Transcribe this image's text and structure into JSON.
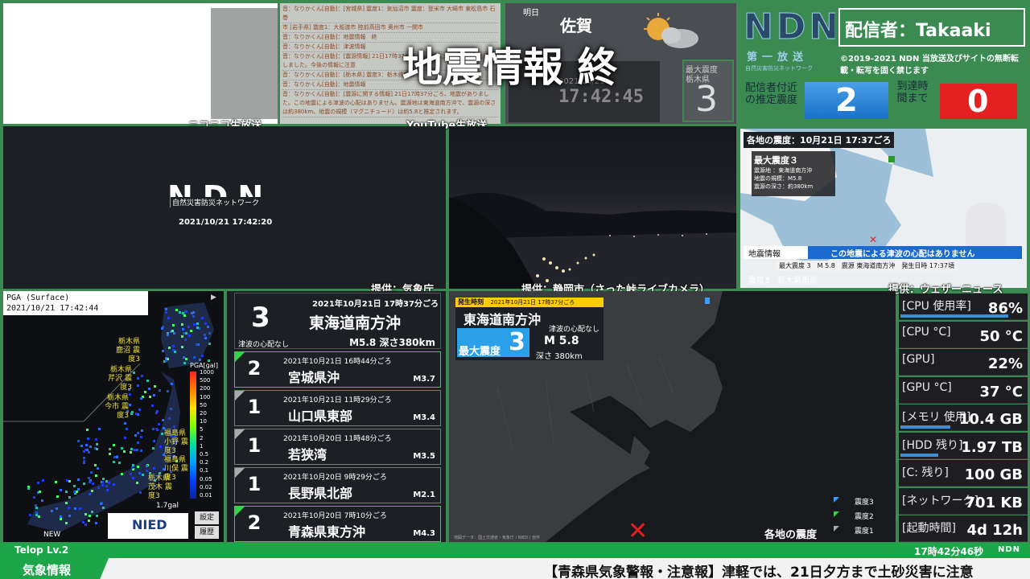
{
  "panels": {
    "niconico": "ニコニコ生放送",
    "youtube": "YouTube生放送",
    "kisho": "提供：気象庁",
    "shizuoka": "提供：静岡市（さった峠ライブカメラ）",
    "weathernews": "提供：ウェザーニュース"
  },
  "chat_lines": [
    "音：なりかくん[自動]：[宮城県] 震度1：気仙沼市 震度：登米市 大崎市 東松島市 石巻",
    "市 [岩手県] 震度1：大船渡市 陸前高田市 奥州市 一関市",
    "音：なりかくん[自動]：地震情報　終",
    "音：なりかくん[自動]：津波情報",
    "音：なりかくん[自動]：[震源情報] 21日17時37分ごろ、地震による強い揺れを観測しました。今後の情報に注意",
    "音：なりかくん[自動]：[栃木県] 震度3：栃木県南部",
    "音：なりかくん[自動]：地震情報",
    "音：なりかくん[自動]：[震源に関する情報] 21日17時37分ごろ、地震がありました。この地震による津波の心配はありません。震源地は東海道南方沖で、震源の深さは約380km、地震の規模（マグニチュード）は約5.8と推定されます。"
  ],
  "overlay_title": "地震情報 終",
  "weather": {
    "tomorrow": "明日",
    "city": "佐賀"
  },
  "clock": {
    "date": "2021/10/21",
    "time": "17:42:45"
  },
  "max_intensity_box": {
    "label": "最大震度",
    "region": "栃木県",
    "value": "3"
  },
  "ndn": {
    "logo": "NDN",
    "subtitle": "第一放送",
    "sub2": "自然災害防災ネットワーク",
    "broadcaster": "配信者：Takaaki",
    "copyright": "©2019-2021 NDN 当放送及びサイトの無断転載・転写を固く禁じます",
    "est_label": "配信者付近の推定震度",
    "est_value": "2",
    "arrival_label": "到達時間まで",
    "arrival_value": "0"
  },
  "logo_panel": {
    "logo": "NDN",
    "sub": "自然災害防災ネットワーク",
    "datetime": "2021/10/21 17:42:20"
  },
  "wni": {
    "header": "各地の震度：10月21日 17:37ごろ",
    "max_label": "最大震度３",
    "lines": [
      "震源地 ：東海道南方沖",
      "地震の規模：M5.8",
      "震源の深さ：約380km"
    ],
    "banner_tag": "地震情報",
    "banner_text": "この地震による津波の心配はありません",
    "bottom": "最大震度 3　M 5.8　震源 東海道南方沖　発生日時 17:37頃",
    "corner_tag": "震度3",
    "corner_region": "栃木県南部"
  },
  "pga": {
    "label": "PGA (Surface)",
    "datetime": "2021/10/21 17:42:44",
    "unit": "PGA[gal]",
    "scale": [
      "1000",
      "500",
      "200",
      "100",
      "50",
      "20",
      "10",
      "5",
      "2",
      "1",
      "0.5",
      "0.2",
      "0.1",
      "0.05",
      "0.02",
      "0.01"
    ],
    "annotations": [
      "栃木県 鹿沼 震度3",
      "栃木県 芹沢 震度3",
      "栃木県 今市 震度3",
      "福島県 小野 震度3",
      "福島県 川俣 震度3",
      "栃木県 茂木 震度3"
    ],
    "footer_value": "1.7gal",
    "new_label": "NEW",
    "nied": "NIED",
    "btn_settings": "設定",
    "btn_history": "履歴"
  },
  "quake_main": {
    "intensity": "3",
    "datetime": "2021年10月21日 17時37分ごろ",
    "place": "東海道南方沖",
    "tsunami": "津波の心配なし",
    "detail": "M5.8 深さ380km"
  },
  "quake_list": [
    {
      "intensity": "2",
      "datetime": "2021年10月21日 16時44分ごろ",
      "place": "宮城県沖",
      "mag": "M3.7"
    },
    {
      "intensity": "1",
      "datetime": "2021年10月21日 11時29分ごろ",
      "place": "山口県東部",
      "mag": "M3.4"
    },
    {
      "intensity": "1",
      "datetime": "2021年10月20日 11時48分ごろ",
      "place": "若狭湾",
      "mag": "M3.5"
    },
    {
      "intensity": "1",
      "datetime": "2021年10月20日 9時29分ごろ",
      "place": "長野県北部",
      "mag": "M2.1"
    },
    {
      "intensity": "2",
      "datetime": "2021年10月20日 7時10分ごろ",
      "place": "青森県東方沖",
      "mag": "M4.3"
    }
  ],
  "map": {
    "tag": "発生時刻",
    "tag_datetime": "2021年10月21日 17時37分ごろ",
    "place": "東海道南方沖",
    "tsunami": "津波の心配なし",
    "max_label": "最大震度",
    "max_value": "3",
    "mag": "M 5.8",
    "depth": "深さ 380km",
    "legend": [
      "震度3",
      "震度2",
      "震度1"
    ],
    "footer": "各地の震度",
    "credit": "地図データ：国土交通省・気象庁 / NIED / 自作"
  },
  "stats": [
    {
      "label": "[CPU 使用率]",
      "value": "86%",
      "bar": 0.86
    },
    {
      "label": "[CPU °C]",
      "value": "50 °C",
      "bar": 0
    },
    {
      "label": "[GPU]",
      "value": "22%",
      "bar": 0
    },
    {
      "label": "[GPU °C]",
      "value": "37 °C",
      "bar": 0
    },
    {
      "label": "[メモリ 使用]",
      "value": "10.4 GB",
      "bar": 0.4
    },
    {
      "label": "[HDD 残り]",
      "value": "1.97 TB",
      "bar": 0.3
    },
    {
      "label": "[C: 残り]",
      "value": "100 GB",
      "bar": 0
    },
    {
      "label": "[ネットワーク]",
      "value": "701 KB",
      "bar": 0
    },
    {
      "label": "[起動時間]",
      "value": "4d 12h",
      "bar": 0
    }
  ],
  "status_bar": {
    "telop": "Telop Lv.2",
    "time": "17時42分46秒",
    "brand": "NDN"
  },
  "ticker": {
    "tag": "気象情報",
    "text": "【青森県気象警報・注意報】津軽では、21日夕方まで土砂災害に注意"
  }
}
